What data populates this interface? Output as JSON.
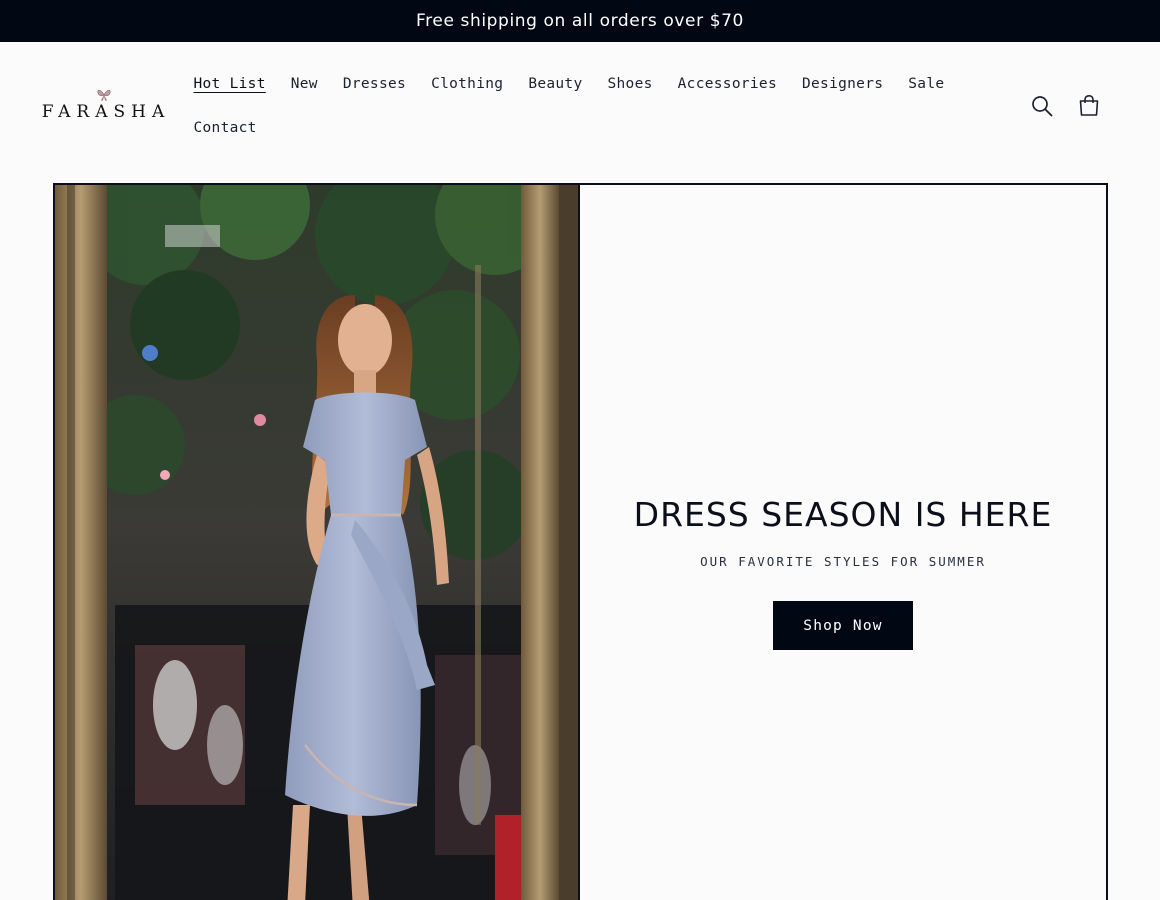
{
  "announcement": {
    "text": "Free shipping on all orders over $70"
  },
  "header": {
    "logo_text": "FARASHA",
    "nav": [
      {
        "label": "Hot List",
        "active": true
      },
      {
        "label": "New"
      },
      {
        "label": "Dresses"
      },
      {
        "label": "Clothing"
      },
      {
        "label": "Beauty"
      },
      {
        "label": "Shoes"
      },
      {
        "label": "Accessories"
      },
      {
        "label": "Designers"
      },
      {
        "label": "Sale"
      },
      {
        "label": "Contact"
      }
    ],
    "icons": [
      "search-icon",
      "cart-icon"
    ]
  },
  "banner": {
    "heading": "DRESS SEASON IS HERE",
    "subheading": "OUR FAVORITE STYLES FOR SUMMER",
    "button_label": "Shop Now",
    "image": "woman-in-lavender-dress-photo"
  },
  "colors": {
    "announcement_bg": "#020813",
    "button_bg": "#020813",
    "page_bg": "#fbfbfc",
    "dress": "#a7b4d2"
  }
}
